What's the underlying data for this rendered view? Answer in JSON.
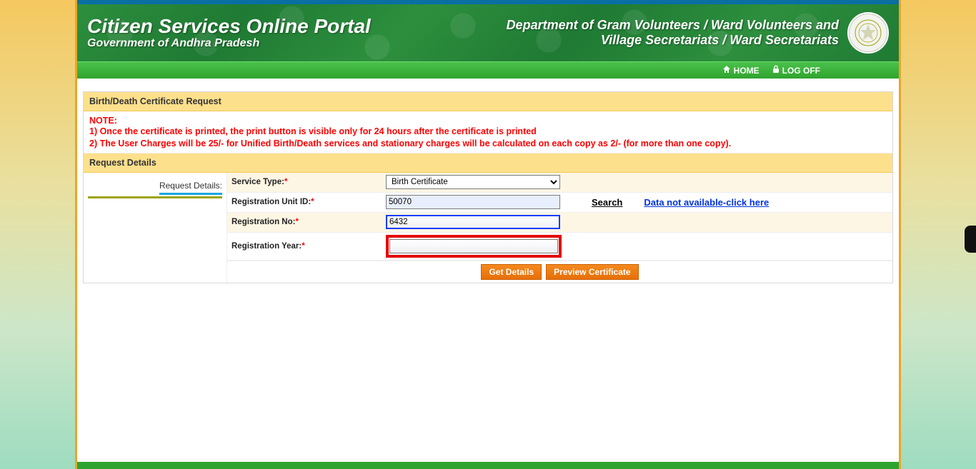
{
  "header": {
    "title": "Citizen Services Online Portal",
    "subtitle": "Government of Andhra Pradesh",
    "department": "Department of Gram Volunteers / Ward Volunteers and Village Secretariats / Ward Secretariats"
  },
  "nav": {
    "home": "HOME",
    "logoff": "LOG OFF"
  },
  "panel": {
    "title": "Birth/Death Certificate Request",
    "note_heading": "NOTE:",
    "note_line1": "1) Once the certificate is printed, the print button is visible only for 24 hours after the certificate is printed",
    "note_line2": "2) The User Charges will be 25/- for Unified Birth/Death services and stationary charges will be calculated on each copy as 2/- (for more than one copy).",
    "section_title": "Request Details",
    "side_label": "Request Details:"
  },
  "form": {
    "service_type_label": "Service Type:",
    "service_type_value": "Birth Certificate",
    "reg_unit_label": "Registration Unit ID:",
    "reg_unit_value": "50070",
    "reg_no_label": "Registration No:",
    "reg_no_value": "6432",
    "reg_year_label": "Registration Year:",
    "reg_year_value": "",
    "search_label": "Search",
    "dna_label": "Data not available-click here"
  },
  "buttons": {
    "get_details": "Get Details",
    "preview": "Preview Certificate"
  }
}
